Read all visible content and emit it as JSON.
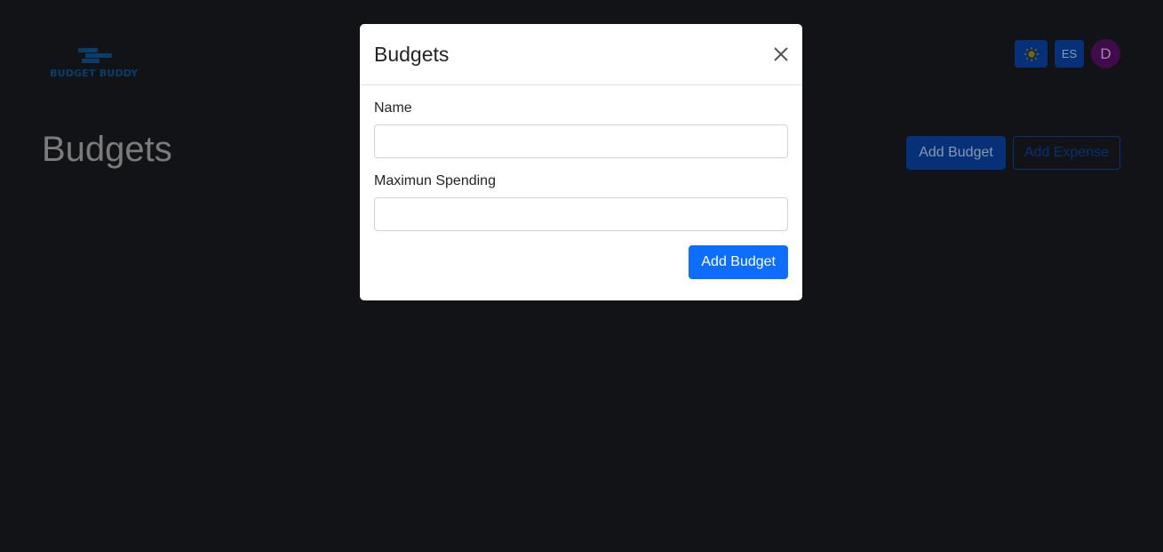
{
  "header": {
    "logo_text": "BUDGET BUDDY",
    "language_label": "ES",
    "avatar_initial": "D",
    "theme_icon": "sun-icon"
  },
  "main": {
    "title": "Budgets",
    "add_budget_label": "Add Budget",
    "add_expense_label": "Add Expense"
  },
  "modal": {
    "title": "Budgets",
    "close_icon": "close-icon",
    "name_label": "Name",
    "name_value": "",
    "max_spending_label": "Maximun Spending",
    "max_spending_value": "",
    "submit_label": "Add Budget"
  },
  "colors": {
    "primary": "#0d6efd",
    "background": "#121316",
    "backdrop_button": "#063179",
    "avatar": "#3f0b4a"
  }
}
